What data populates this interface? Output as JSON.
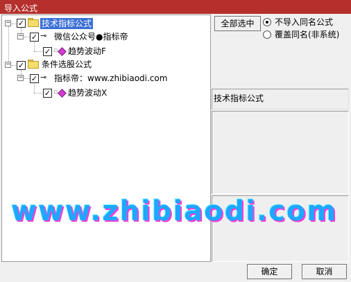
{
  "window": {
    "title": "导入公式"
  },
  "tree": {
    "groups": [
      {
        "label": "技术指标公式",
        "checked": true,
        "selected": true,
        "children": [
          {
            "label": "微信公众号●指标帝",
            "checked": true,
            "children": [
              {
                "label": "趋势波动F",
                "checked": true
              }
            ]
          }
        ]
      },
      {
        "label": "条件选股公式",
        "checked": true,
        "selected": false,
        "children": [
          {
            "label": "指标帝：www.zhibiaodi.com",
            "checked": true,
            "children": [
              {
                "label": "趋势波动X",
                "checked": true
              }
            ]
          }
        ]
      }
    ]
  },
  "options": {
    "select_all_label": "全部选中",
    "radio_options": [
      {
        "label": "不导入同名公式",
        "selected": true
      },
      {
        "label": "覆盖同名(非系统)",
        "selected": false
      }
    ]
  },
  "info": {
    "category_label": "技术指标公式"
  },
  "watermark": "www.zhibiaodi.com",
  "footer": {
    "ok_label": "确定",
    "cancel_label": "取消"
  },
  "icons": {
    "expand": "minus-box-icon",
    "folder": "folder-icon",
    "key": "key-icon",
    "formula": "diamond-formula-icon",
    "checkbox": "checkbox-icon",
    "radio": "radio-icon"
  },
  "colors": {
    "titlebar": "#b5302c",
    "selection": "#3b6fd4",
    "watermark": "#1ea7ff",
    "watermark_shadow": "#ff3ad6"
  }
}
